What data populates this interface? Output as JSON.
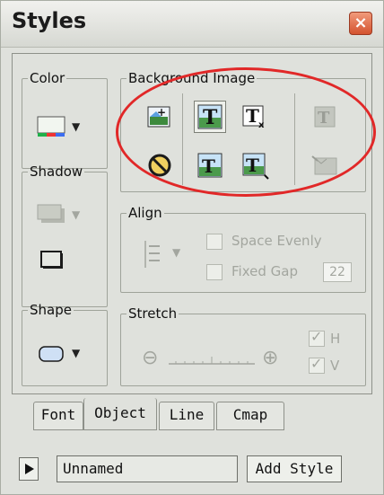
{
  "window": {
    "title": "Styles",
    "close_glyph": "×"
  },
  "groups": {
    "color": "Color",
    "shadow": "Shadow",
    "shape": "Shape",
    "background_image": "Background Image",
    "align": "Align",
    "stretch": "Stretch"
  },
  "align": {
    "space_evenly": "Space Evenly",
    "fixed_gap": "Fixed Gap",
    "gap_value": "22"
  },
  "stretch": {
    "h_label": "H",
    "v_label": "V",
    "minus_glyph": "⊖",
    "plus_glyph": "⊕"
  },
  "tabs": [
    {
      "label": "Font"
    },
    {
      "label": "Object"
    },
    {
      "label": "Line"
    },
    {
      "label": "Cmap"
    }
  ],
  "active_tab": "Object",
  "footer": {
    "style_name": "Unnamed",
    "add_style_label": "Add Style"
  },
  "colors": {
    "annotation_ellipse": "#e12828",
    "close_button": "#d4532f"
  },
  "icons": [
    "close-icon",
    "color-swatch-icon",
    "shadow-icon",
    "shadow-box-icon",
    "rounded-rect-icon",
    "insert-image-icon",
    "no-image-icon",
    "text-on-image-icon",
    "text-clear-icon",
    "text-tile-icon",
    "text-resize-icon",
    "image-faded-icon",
    "image-broken-icon",
    "align-spacing-icon",
    "play-icon"
  ]
}
